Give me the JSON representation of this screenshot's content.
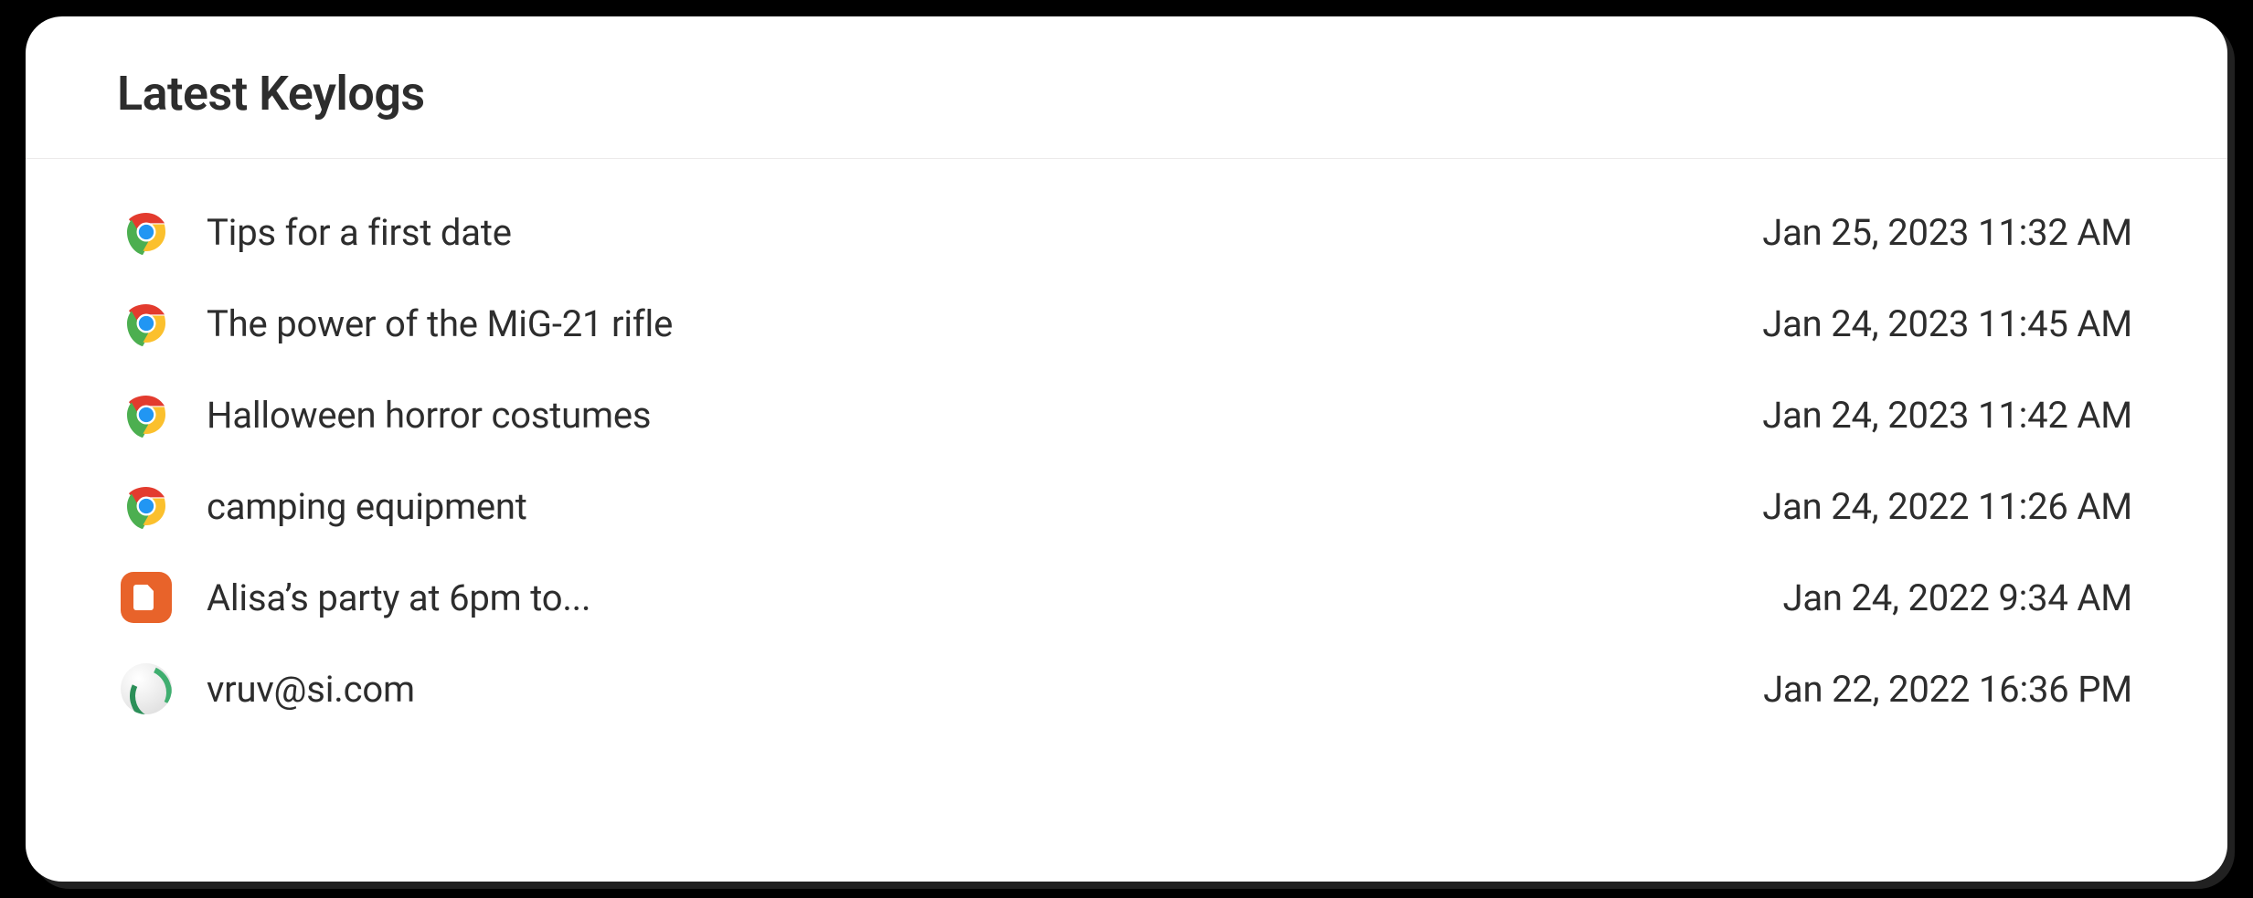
{
  "title": "Latest Keylogs",
  "rows": [
    {
      "icon": "chrome",
      "text": "Tips for a first date",
      "ts": "Jan 25, 2023 11:32 AM"
    },
    {
      "icon": "chrome",
      "text": "The power of the MiG-21 rifle",
      "ts": "Jan 24, 2023 11:45 AM"
    },
    {
      "icon": "chrome",
      "text": "Halloween horror costumes",
      "ts": "Jan 24, 2023 11:42 AM"
    },
    {
      "icon": "chrome",
      "text": "camping equipment",
      "ts": "Jan 24, 2022 11:26 AM"
    },
    {
      "icon": "notes",
      "text": "Alisa’s party at 6pm to...",
      "ts": "Jan 24, 2022 9:34 AM"
    },
    {
      "icon": "globe",
      "text": "vruv@si.com",
      "ts": "Jan 22, 2022 16:36 PM"
    }
  ]
}
